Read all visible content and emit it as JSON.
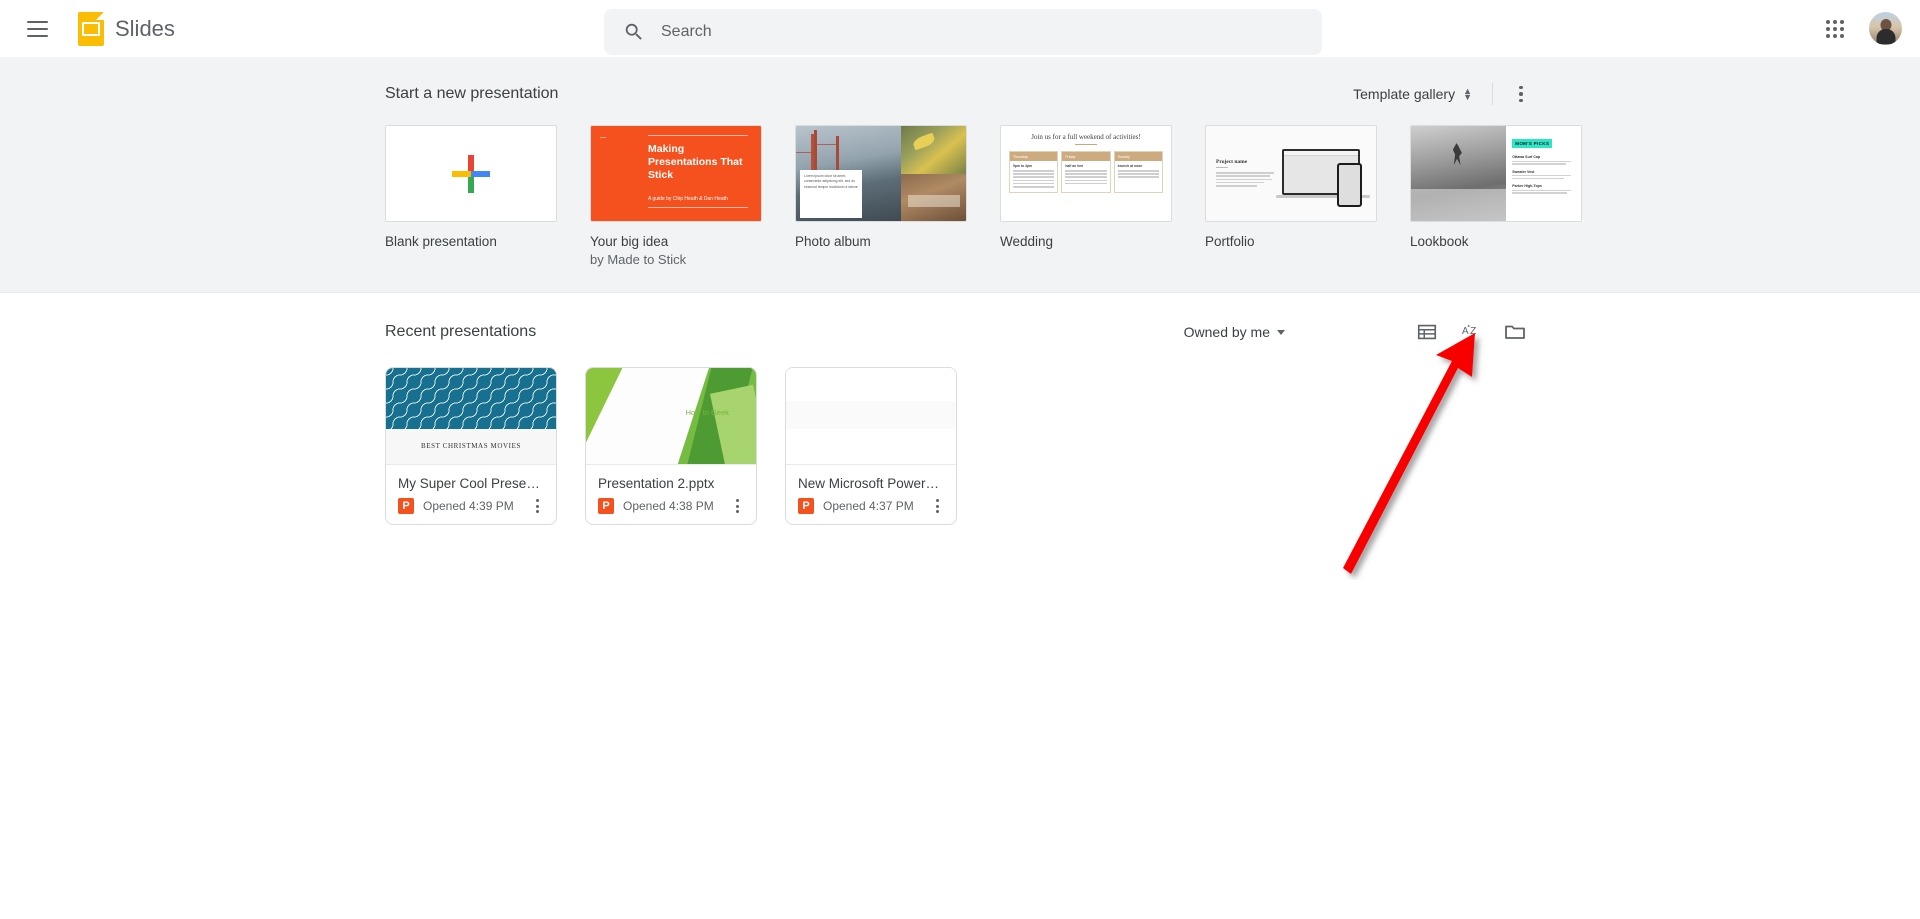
{
  "header": {
    "menu_icon": "hamburger-menu-icon",
    "logo_icon": "google-slides-logo-icon",
    "title": "Slides",
    "search": {
      "icon": "search-icon",
      "placeholder": "Search",
      "value": ""
    },
    "apps_icon": "google-apps-grid-icon",
    "avatar": "user-avatar"
  },
  "templates": {
    "heading": "Start a new presentation",
    "gallery_label": "Template gallery",
    "gallery_toggle_icon": "unfold-more-icon",
    "more_icon": "more-vert-icon",
    "items": [
      {
        "label": "Blank presentation",
        "sub": "",
        "thumb": "blank-plus"
      },
      {
        "label": "Your big idea",
        "sub": "by Made to Stick",
        "thumb": "big-idea",
        "thumb_text": {
          "title": "Making Presentations That Stick",
          "byline": "A guide by Chip Heath & Dan Heath"
        }
      },
      {
        "label": "Photo album",
        "sub": "",
        "thumb": "photo-album",
        "thumb_text": {
          "caption": "Lorem ipsum dolor sit amet, consectetur adipiscing elit, sed do eiusmod tempor incididunt ut labore"
        }
      },
      {
        "label": "Wedding",
        "sub": "",
        "thumb": "wedding",
        "thumb_text": {
          "title": "Join us for a full weekend of activities!",
          "col1": "Thursday",
          "col2": "Friday",
          "col3": "Sunday",
          "col1_sub": "5pm to 4pm",
          "col2_sub": "half an hen",
          "col3_sub": "brunch at noon"
        }
      },
      {
        "label": "Portfolio",
        "sub": "",
        "thumb": "portfolio",
        "thumb_text": {
          "title": "Project name"
        }
      },
      {
        "label": "Lookbook",
        "sub": "",
        "thumb": "lookbook",
        "thumb_text": {
          "tag": "MOM'S PICKS",
          "i1": "Ottawa Surf Cap",
          "i2": "Sweater Vest",
          "i3": "Parker High-Tops"
        }
      }
    ]
  },
  "recent": {
    "heading": "Recent presentations",
    "owner_filter": "Owned by me",
    "owner_caret_icon": "caret-down-icon",
    "list_view_icon": "list-view-icon",
    "sort_icon": "sort-az-icon",
    "folder_icon": "folder-open-icon",
    "files": [
      {
        "title": "My Super Cool Presentati...",
        "opened": "Opened 4:39 PM",
        "badge": "P",
        "thumb": "christmas-movies",
        "thumb_text": "BEST CHRISTMAS MOVIES"
      },
      {
        "title": "Presentation 2.pptx",
        "opened": "Opened 4:38 PM",
        "badge": "P",
        "thumb": "how-to-geek",
        "thumb_text": "How to Geek"
      },
      {
        "title": "New Microsoft PowerPoi...",
        "opened": "Opened 4:37 PM",
        "badge": "P",
        "thumb": "blank",
        "thumb_text": ""
      }
    ]
  },
  "annotation": {
    "type": "red-arrow",
    "color": "#f90000",
    "points_to": "folder-open-icon"
  }
}
